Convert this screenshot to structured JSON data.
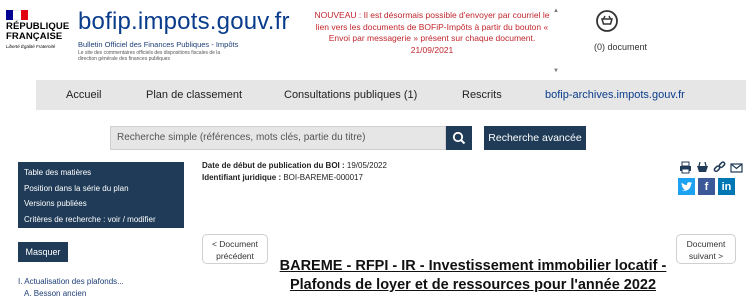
{
  "header": {
    "logo_line1": "RÉPUBLIQUE",
    "logo_line2": "FRANÇAISE",
    "logo_motto": "Liberté Égalité Fraternité",
    "site_name": "bofip.impots.gouv.fr",
    "site_subtitle": "Bulletin Officiel des Finances Publiques - Impôts",
    "site_subtitle_small": "Le site des commentaires officiels des dispositions fiscales de la direction générale des finances publiques",
    "news": "NOUVEAU : Il est désormais possible d'envoyer par courriel le lien vers les documents de BOFiP-Impôts à partir du bouton « Envoi par messagerie » présent sur chaque document.  21/09/2021",
    "cart_count": "(0) document"
  },
  "nav": {
    "items": [
      {
        "label": "Accueil"
      },
      {
        "label": "Plan de classement"
      },
      {
        "label": "Consultations publiques (1)"
      },
      {
        "label": "Rescrits"
      },
      {
        "label": "bofip-archives.impots.gouv.fr"
      }
    ]
  },
  "search": {
    "placeholder": "Recherche simple (références, mots clés, partie du titre)",
    "advanced_label": "Recherche avancée"
  },
  "sidebar": {
    "items": [
      {
        "label": "Table des matières"
      },
      {
        "label": "Position dans la série du plan"
      },
      {
        "label": "Versions publiées"
      },
      {
        "label": "Critères de recherche : voir / modifier"
      }
    ],
    "mask_label": "Masquer",
    "toc": [
      "I. Actualisation des plafonds...",
      "A. Besson ancien"
    ]
  },
  "meta": {
    "date_label": "Date de début de publication du BOI :",
    "date_value": "19/05/2022",
    "id_label": "Identifiant juridique :",
    "id_value": "BOI-BAREME-000017"
  },
  "pager": {
    "prev_line1": "< Document",
    "prev_line2": "précédent",
    "next_line1": "Document",
    "next_line2": "suivant >"
  },
  "document": {
    "title": "BAREME - RFPI - IR - Investissement immobilier locatif - Plafonds de loyer et de ressources pour l'année 2022"
  },
  "colors": {
    "primary_dark": "#1f3b57",
    "brand_blue": "#0a3c8c",
    "news_red": "#c0262d",
    "nav_bg": "#e6e6e6"
  },
  "icons": [
    "print-icon",
    "basket-icon",
    "link-icon",
    "email-icon",
    "twitter-icon",
    "facebook-icon",
    "linkedin-icon",
    "search-icon",
    "cart-icon"
  ]
}
